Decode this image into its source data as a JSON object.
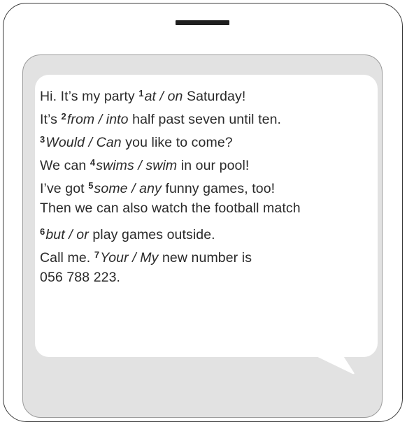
{
  "message_lines": [
    [
      {
        "t": "Hi. It’s my party "
      },
      {
        "t": "1",
        "num": true
      },
      {
        "t": "at / on",
        "opt": true
      },
      {
        "t": " Saturday!"
      }
    ],
    [
      {
        "t": "It’s "
      },
      {
        "t": "2",
        "num": true
      },
      {
        "t": "from / into",
        "opt": true
      },
      {
        "t": " half past seven until ten."
      }
    ],
    [
      {
        "t": "3",
        "num": true
      },
      {
        "t": "Would / Can",
        "opt": true
      },
      {
        "t": " you like to come?"
      }
    ],
    [
      {
        "t": "We can "
      },
      {
        "t": "4",
        "num": true
      },
      {
        "t": "swims / swim",
        "opt": true
      },
      {
        "t": " in our pool!"
      }
    ],
    [
      {
        "t": "I’ve got "
      },
      {
        "t": "5",
        "num": true
      },
      {
        "t": "some / any",
        "opt": true
      },
      {
        "t": " funny games, too!"
      }
    ],
    [
      {
        "t": "Then we can also watch the football match"
      }
    ],
    [
      {
        "t": "6",
        "num": true
      },
      {
        "t": "but / or",
        "opt": true
      },
      {
        "t": " play games outside."
      }
    ],
    [
      {
        "t": "Call me. "
      },
      {
        "t": "7",
        "num": true
      },
      {
        "t": "Your / My",
        "opt": true
      },
      {
        "t": " new number is"
      }
    ],
    [
      {
        "t": "056 788 223."
      }
    ]
  ],
  "colors": {
    "phone_border": "#3a3a3a",
    "screen_bg": "#e2e2e2",
    "bubble_bg": "#ffffff",
    "text": "#2a2a2a"
  }
}
